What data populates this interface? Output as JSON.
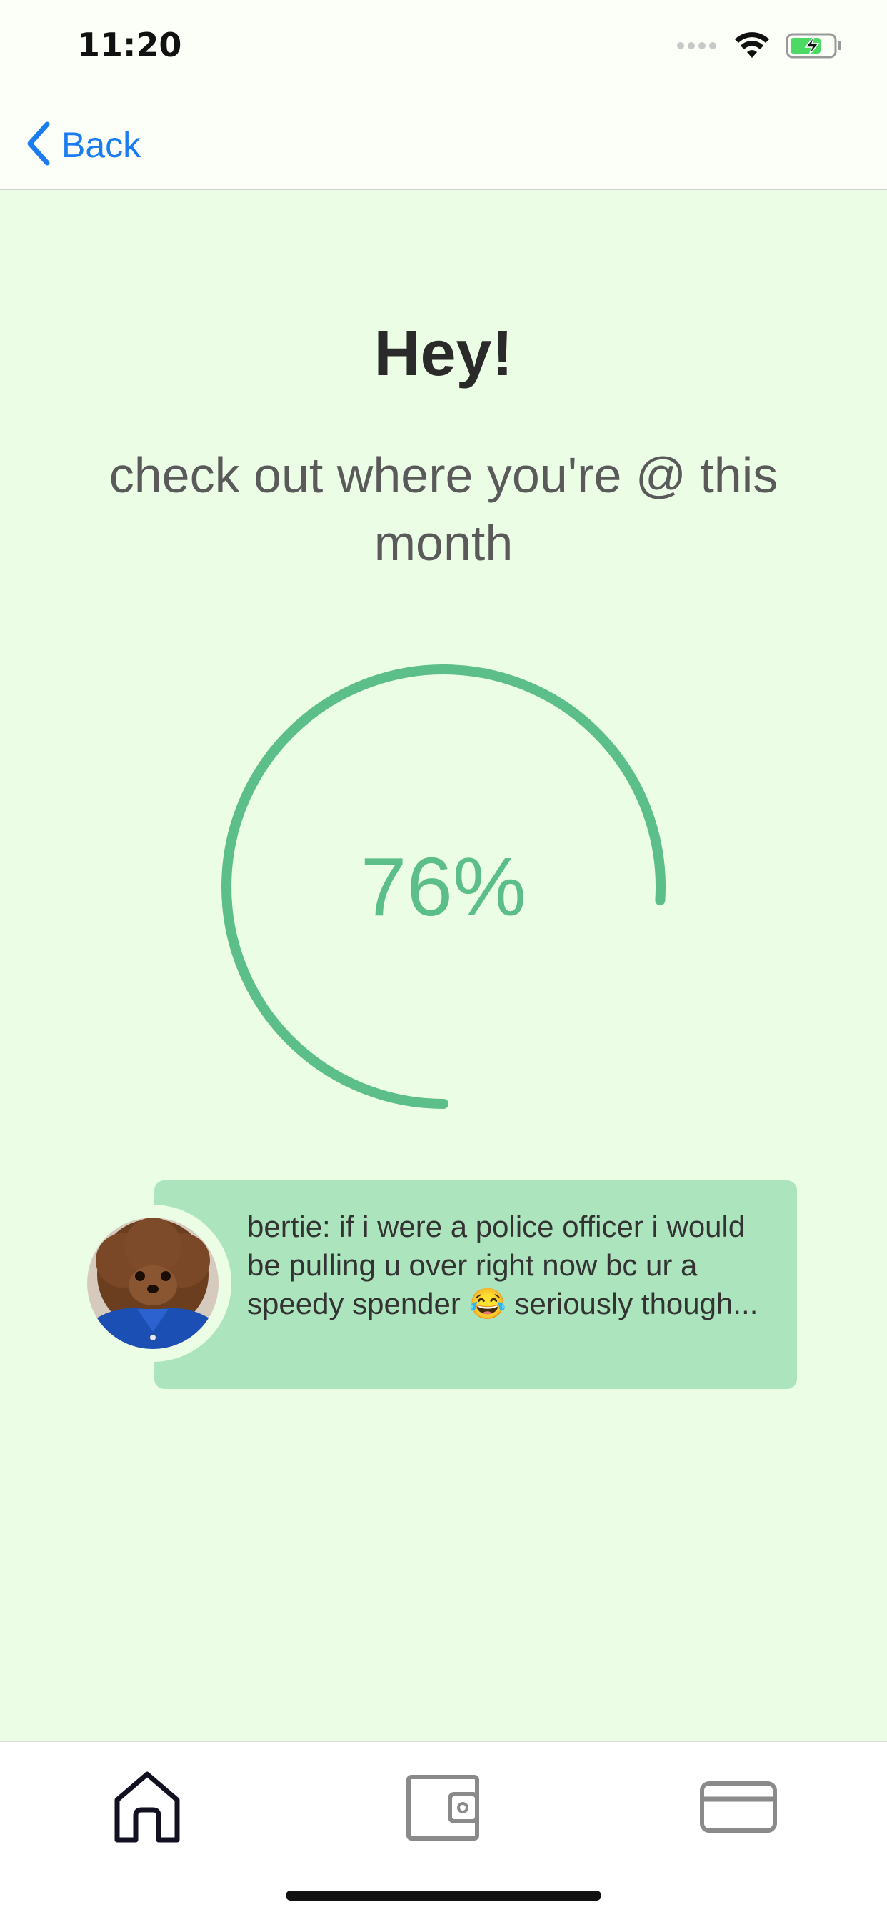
{
  "status_bar": {
    "time": "11:20",
    "icons": [
      "signal-dots-icon",
      "wifi-icon",
      "battery-charging-icon"
    ]
  },
  "nav": {
    "back_label": "Back",
    "back_icon": "chevron-left-icon"
  },
  "main": {
    "greeting": "Hey!",
    "subtitle": "check out where you're @ this month",
    "progress": {
      "value": 0.76,
      "label": "76%",
      "color": "#5cbe88"
    }
  },
  "message": {
    "text": "bertie: if i were a police officer i would be pulling u over right now bc ur a speedy spender 😂 seriously though...",
    "avatar_icon": "dog-avatar-icon",
    "card_color": "#ace4bd"
  },
  "tab_bar": {
    "tabs": [
      {
        "icon": "home-icon",
        "active": true
      },
      {
        "icon": "wallet-icon",
        "active": false
      },
      {
        "icon": "credit-card-icon",
        "active": false
      }
    ]
  },
  "colors": {
    "background": "#ebfde5",
    "accent_blue": "#1a7cf0",
    "progress_green": "#5cbe88"
  }
}
